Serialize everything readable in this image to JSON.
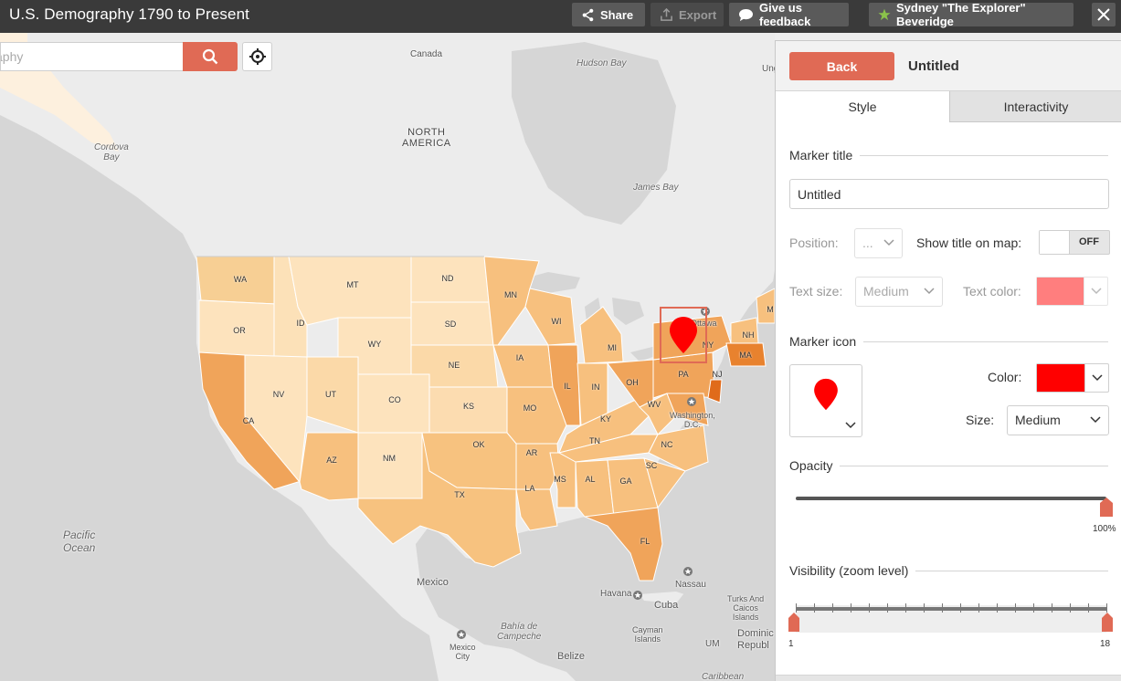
{
  "topbar": {
    "title": "U.S. Demography 1790 to Present",
    "share_label": "Share",
    "export_label": "Export",
    "feedback_label": "Give us feedback",
    "user_label": "Sydney \"The Explorer\" Beveridge"
  },
  "search": {
    "value_visible": "aphy"
  },
  "map": {
    "labels": {
      "canada": "Canada",
      "hudson_bay": "Hudson Bay",
      "ung": "Ung",
      "north_america_1": "NORTH",
      "north_america_2": "AMERICA",
      "cordova_1": "Cordova",
      "cordova_2": "Bay",
      "james_bay": "James Bay",
      "pacific_1": "Pacific",
      "pacific_2": "Ocean",
      "mexico": "Mexico",
      "havana": "Havana",
      "cuba": "Cuba",
      "nassau": "Nassau",
      "turks_1": "Turks And",
      "turks_2": "Caicos",
      "turks_3": "Islands",
      "bahia_1": "Bahía de",
      "bahia_2": "Campeche",
      "mexico_city_1": "Mexico",
      "mexico_city_2": "City",
      "cayman_1": "Cayman",
      "cayman_2": "Islands",
      "dominican_1": "Dominic",
      "dominican_2": "Republ",
      "belize": "Belize",
      "um": "UM",
      "caribbean": "Caribbean",
      "ottawa": "Ottawa",
      "washington_1": "Washington,",
      "washington_2": "D.C."
    },
    "states": {
      "WA": "WA",
      "OR": "OR",
      "CA": "CA",
      "ID": "ID",
      "NV": "NV",
      "MT": "MT",
      "WY": "WY",
      "UT": "UT",
      "AZ": "AZ",
      "CO": "CO",
      "NM": "NM",
      "ND": "ND",
      "SD": "SD",
      "NE": "NE",
      "KS": "KS",
      "OK": "OK",
      "TX": "TX",
      "MN": "MN",
      "IA": "IA",
      "MO": "MO",
      "AR": "AR",
      "LA": "LA",
      "WI": "WI",
      "IL": "IL",
      "MS": "MS",
      "MI": "MI",
      "IN": "IN",
      "KY": "KY",
      "TN": "TN",
      "AL": "AL",
      "GA": "GA",
      "FL": "FL",
      "OH": "OH",
      "WV": "WV",
      "NC": "NC",
      "SC": "SC",
      "PA": "PA",
      "NY": "NY",
      "NJ": "NJ",
      "NH": "NH",
      "MA": "MA",
      "M": "M"
    }
  },
  "panel": {
    "back_label": "Back",
    "title": "Untitled",
    "tabs": {
      "style": "Style",
      "interactivity": "Interactivity"
    },
    "marker_title_section": "Marker title",
    "marker_title_value": "Untitled",
    "position_label": "Position:",
    "position_value": "...",
    "show_title_label": "Show title on map:",
    "toggle_off": "OFF",
    "text_size_label": "Text size:",
    "text_size_value": "Medium",
    "text_color_label": "Text color:",
    "marker_icon_section": "Marker icon",
    "color_label": "Color:",
    "size_label": "Size:",
    "size_value": "Medium",
    "opacity_section": "Opacity",
    "opacity_value": "100%",
    "opacity_fraction": 1.0,
    "visibility_section": "Visibility (zoom level)",
    "zoom_min": "1",
    "zoom_max": "18"
  },
  "colors": {
    "accent": "#e06a55",
    "marker": "#ff0000",
    "text_color_swatch": "#ff8080",
    "topbar": "#3a3a3a"
  }
}
